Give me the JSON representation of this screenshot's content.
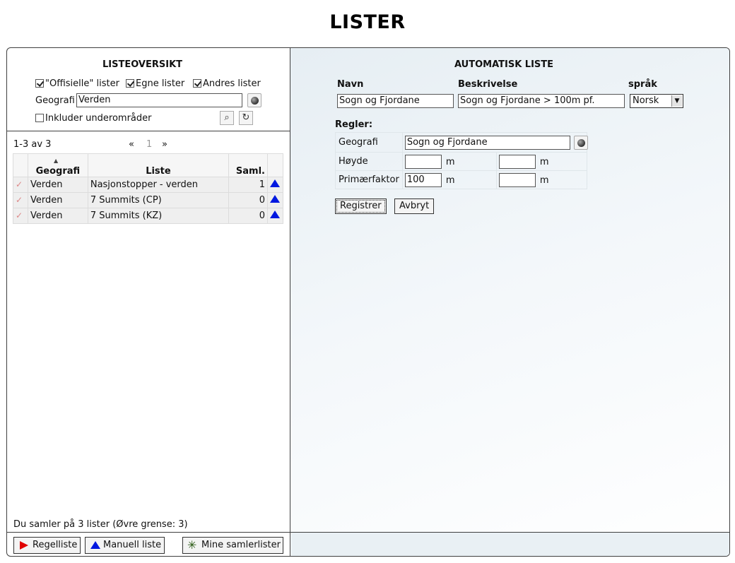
{
  "page": {
    "title": "LISTER"
  },
  "left": {
    "title": "LISTEOVERSIKT",
    "filters": {
      "official": {
        "label": "\"Offisielle\" lister",
        "checked": true
      },
      "own": {
        "label": "Egne lister",
        "checked": true
      },
      "others": {
        "label": "Andres lister",
        "checked": true
      }
    },
    "geo_label": "Geografi",
    "geo_value": "Verden",
    "include_sub": {
      "label": "Inkluder underområder",
      "checked": false
    },
    "pager": {
      "range": "1-3 av 3",
      "prev": "«",
      "page": "1",
      "next": "»"
    },
    "table": {
      "headers": [
        "Geografi",
        "Liste",
        "Saml."
      ],
      "rows": [
        {
          "geo": "Verden",
          "list": "Nasjonstopper - verden",
          "count": "1"
        },
        {
          "geo": "Verden",
          "list": "7 Summits (CP)",
          "count": "0"
        },
        {
          "geo": "Verden",
          "list": "7 Summits (KZ)",
          "count": "0"
        }
      ]
    },
    "status": "Du samler på 3 lister (Øvre grense: 3)",
    "buttons": {
      "rule_list": "Regelliste",
      "manual_list": "Manuell liste",
      "my_lists": "Mine samlerlister"
    }
  },
  "right": {
    "title": "AUTOMATISK LISTE",
    "name_label": "Navn",
    "desc_label": "Beskrivelse",
    "lang_label": "språk",
    "name_value": "Sogn og Fjordane",
    "desc_value": "Sogn og Fjordane > 100m pf.",
    "lang_value": "Norsk",
    "rules_label": "Regler:",
    "rules": {
      "geo_label": "Geografi",
      "geo_value": "Sogn og Fjordane",
      "height_label": "Høyde",
      "height_min": "",
      "height_max": "",
      "prom_label": "Primærfaktor",
      "prom_min": "100",
      "prom_max": "",
      "unit": "m"
    },
    "buttons": {
      "register": "Registrer",
      "cancel": "Avbryt"
    }
  },
  "colors": {
    "manual_triangle": "#0018e0",
    "rule_arrow": "#e00000",
    "border": "#3f3f3f"
  }
}
